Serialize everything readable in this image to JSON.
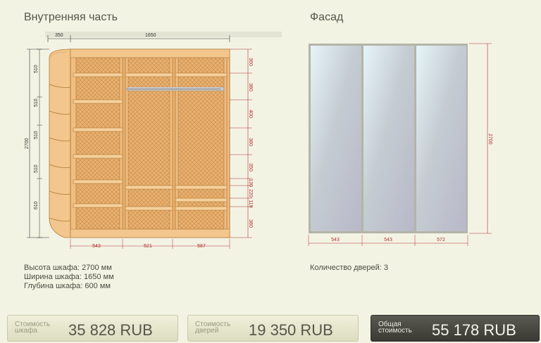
{
  "interior": {
    "title": "Внутренняя часть",
    "top_dims": [
      "350",
      "1650"
    ],
    "height_dim": "2700",
    "left_dims": [
      "510",
      "510",
      "510",
      "510",
      "610"
    ],
    "right_dims": [
      "360",
      "380",
      "400",
      "380",
      "350",
      "130",
      "220",
      "119",
      "380"
    ],
    "bottom_dims": [
      "543",
      "521",
      "587"
    ]
  },
  "facade": {
    "title": "Фасад",
    "height_dim": "2700",
    "bottom_dims": [
      "543",
      "543",
      "572"
    ]
  },
  "specs": {
    "height": "Высота шкафа: 2700 мм",
    "width": "Ширина шкафа: 1650 мм",
    "depth": "Глубина шкафа: 600 мм",
    "doors": "Количество дверей: 3"
  },
  "footer": {
    "cabinet": {
      "label_line1": "Стоимость",
      "label_line2": "шкафа",
      "value": "35 828  RUB"
    },
    "doors": {
      "label_line1": "Стоимость",
      "label_line2": "дверей",
      "value": "19 350  RUB"
    },
    "total": {
      "label_line1": "Общая",
      "label_line2": "стоимость",
      "value": "55 178  RUB"
    }
  },
  "colors": {
    "wood": "#f2c68c",
    "wood_dark": "#d9a060",
    "wood_line": "#b07838",
    "dim_red": "#b03030",
    "mirror": "#c8d4dc",
    "frame": "#b4b4a8"
  }
}
